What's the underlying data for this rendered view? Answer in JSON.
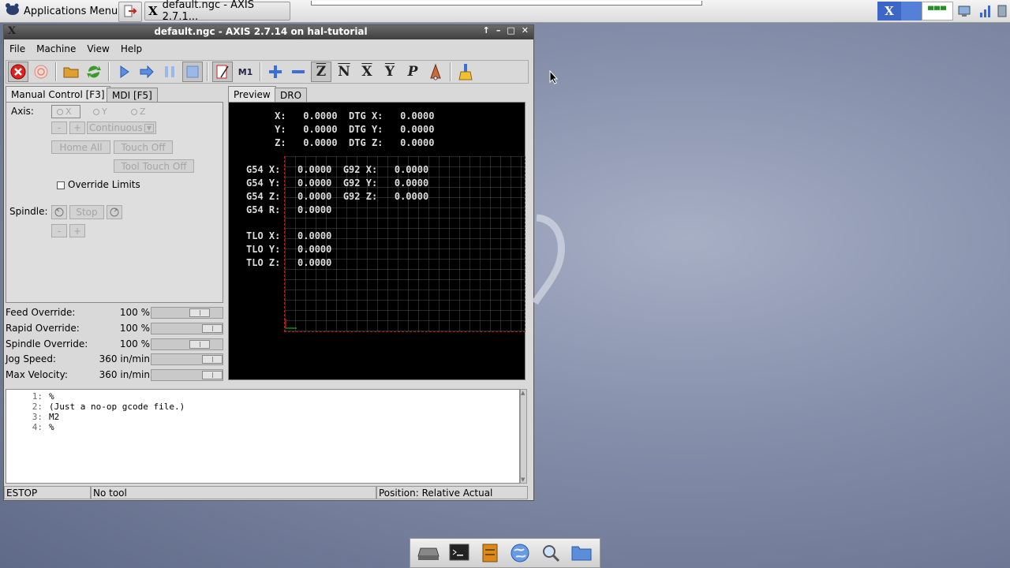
{
  "taskbar": {
    "app_menu_label": "Applications Menu",
    "task_title": "default.ngc - AXIS 2.7.1...",
    "tray_x_label": "X"
  },
  "window": {
    "title": "default.ngc - AXIS 2.7.14 on hal-tutorial",
    "logo": "X",
    "title_buttons": [
      "↑",
      "–",
      "□",
      "✕"
    ]
  },
  "menubar": [
    "File",
    "Machine",
    "View",
    "Help"
  ],
  "toolbar": {
    "icons": [
      "estop-icon",
      "power-icon",
      "open-file-icon",
      "reload-icon",
      "run-icon",
      "step-icon",
      "pause-icon",
      "stop-icon",
      "block-delete-icon",
      "optional-stop-icon",
      "zoom-in-icon",
      "zoom-out-icon",
      "view-z-icon",
      "view-z2-icon",
      "view-x-icon",
      "view-y-icon",
      "view-p-icon",
      "rotate-icon",
      "clear-plot-icon"
    ],
    "view_z": "Z",
    "view_z2": "N",
    "view_x": "X",
    "view_y": "Y",
    "view_p": "P",
    "optional_stop": "M1"
  },
  "tabs": {
    "manual": "Manual Control [F3]",
    "mdi": "MDI [F5]",
    "preview": "Preview",
    "dro": "DRO"
  },
  "manual": {
    "axis_label": "Axis:",
    "axis_options": [
      "X",
      "Y",
      "Z"
    ],
    "jog_minus": "-",
    "jog_plus": "+",
    "increment": "Continuous",
    "home_all": "Home All",
    "touch_off": "Touch Off",
    "tool_touch_off": "Tool Touch Off",
    "override_limits": "Override Limits",
    "spindle_label": "Spindle:",
    "spindle_stop": "Stop",
    "spindle_minus": "-",
    "spindle_plus": "+"
  },
  "overrides": [
    {
      "name": "Feed Override:",
      "value": "100 %",
      "fraction": 0.75
    },
    {
      "name": "Rapid Override:",
      "value": "100 %",
      "fraction": 1.0
    },
    {
      "name": "Spindle Override:",
      "value": "100 %",
      "fraction": 0.75
    },
    {
      "name": "Jog Speed:",
      "value": "360 in/min",
      "fraction": 1.0
    },
    {
      "name": "Max Velocity:",
      "value": "360 in/min",
      "fraction": 1.0
    }
  ],
  "dro": [
    "     X:   0.0000  DTG X:   0.0000",
    "     Y:   0.0000  DTG Y:   0.0000",
    "     Z:   0.0000  DTG Z:   0.0000",
    "",
    "G54 X:   0.0000  G92 X:   0.0000",
    "G54 Y:   0.0000  G92 Y:   0.0000",
    "G54 Z:   0.0000  G92 Z:   0.0000",
    "G54 R:   0.0000",
    "",
    "TLO X:   0.0000",
    "TLO Y:   0.0000",
    "TLO Z:   0.0000"
  ],
  "gcode": [
    {
      "n": "1:",
      "text": "%"
    },
    {
      "n": "2:",
      "text": "(Just a no-op gcode file.)"
    },
    {
      "n": "3:",
      "text": "M2"
    },
    {
      "n": "4:",
      "text": "%"
    }
  ],
  "status": {
    "state": "ESTOP",
    "tool": "No tool",
    "position": "Position: Relative Actual"
  },
  "dock": {
    "icons": [
      "drive-icon",
      "terminal-icon",
      "file-manager-icon",
      "browser-icon",
      "search-icon",
      "folder-icon"
    ]
  }
}
